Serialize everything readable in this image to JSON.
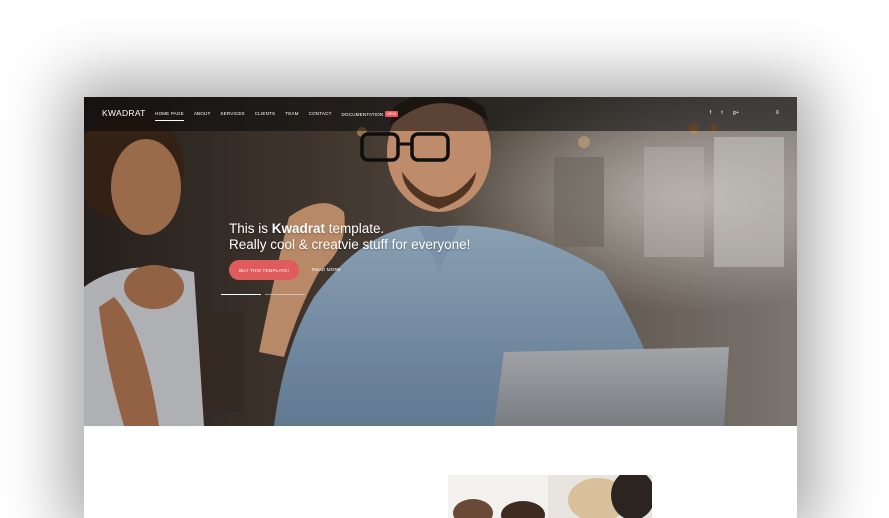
{
  "brand": {
    "logo": "KWADRAT"
  },
  "nav": {
    "items": [
      "HOME PAGE",
      "ABOUT",
      "SERVICES",
      "CLIENTS",
      "TEAM",
      "CONTACT",
      "DOCUMENTATION"
    ],
    "badge": "NEW",
    "social": [
      "f",
      "t",
      "g+"
    ],
    "menu_icon": "hamburger-icon"
  },
  "hero": {
    "line1_prefix": "This is ",
    "line1_strong": "Kwadrat",
    "line1_suffix": " template.",
    "line2": "Really cool & creatvie stuff for everyone!",
    "primary_button": "BUY THIS TEMPLATE!",
    "secondary_link": "READ MORE",
    "accent_color": "#e05c5c",
    "slides": {
      "count": 2,
      "active": 1
    }
  }
}
